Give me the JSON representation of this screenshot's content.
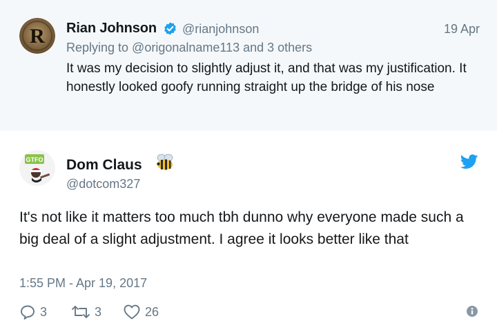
{
  "parent_tweet": {
    "author_name": "Rian Johnson",
    "handle": "@rianjohnson",
    "date": "19 Apr",
    "replying_to": "Replying to @origonalname113 and 3 others",
    "text": "It was my decision to slightly adjust it, and that was my justification. It honestly looked goofy running straight up the bridge of his nose",
    "avatar_letter": "R",
    "verified": true
  },
  "main_tweet": {
    "author_name": "Dom Claus",
    "handle": "@dotcom327",
    "text": "It's not like it matters too much tbh dunno why everyone made such a big deal of a slight adjustment. I agree it looks better like that",
    "timestamp": "1:55 PM - Apr 19, 2017",
    "avatar_badge": "GTFO",
    "name_emoji": "bee-icon",
    "actions": {
      "replies": "3",
      "retweets": "3",
      "likes": "26"
    }
  },
  "colors": {
    "text_primary": "#14171a",
    "text_secondary": "#657786",
    "twitter_blue": "#1da1f2",
    "parent_background": "#f5f8fa"
  },
  "icons": [
    "verified-badge-icon",
    "twitter-bird-icon",
    "reply-icon",
    "retweet-icon",
    "like-icon",
    "info-icon",
    "bee-icon"
  ]
}
